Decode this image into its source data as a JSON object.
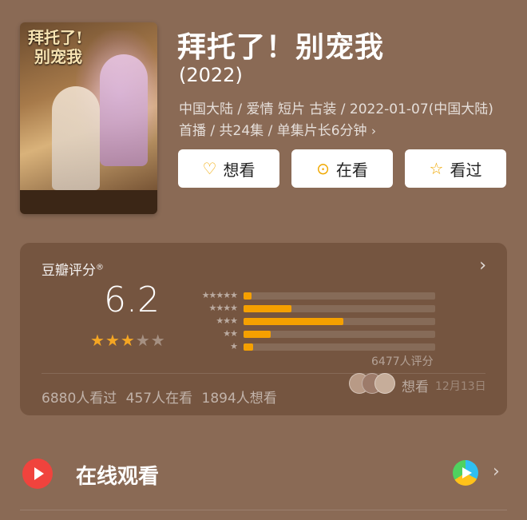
{
  "poster": {
    "title_line1": "拜托了!",
    "title_line2": "别宠我"
  },
  "title": "拜托了！别宠我",
  "year": "(2022)",
  "meta": "中国大陆 / 爱情 短片 古装 / 2022-01-07(中国大陆)首播 / 共24集 / 单集片长6分钟",
  "meta_chevron": "›",
  "buttons": [
    {
      "label": "想看",
      "icon": "heart-plus-icon"
    },
    {
      "label": "在看",
      "icon": "circle-dot-icon"
    },
    {
      "label": "看过",
      "icon": "star-outline-icon"
    }
  ],
  "rating": {
    "title": "豆瓣评分",
    "registered": "®",
    "score": "6.2",
    "stars_filled": 3,
    "stars_total": 5,
    "distribution": [
      {
        "stars": "★★★★★",
        "percent": 4
      },
      {
        "stars": "★★★★",
        "percent": 25
      },
      {
        "stars": "★★★",
        "percent": 52
      },
      {
        "stars": "★★",
        "percent": 14
      },
      {
        "stars": "★",
        "percent": 5
      }
    ],
    "count_text": "6477人评分",
    "stats": "6880人看过 457人在看 1894人想看",
    "want_label": "想看",
    "want_date": "12月13日"
  },
  "watch": {
    "label": "在线观看",
    "provider_icon": "tencent-video-icon"
  },
  "colors": {
    "accent": "#f5a000",
    "play": "#f0433d",
    "background": "#8a6a55"
  }
}
